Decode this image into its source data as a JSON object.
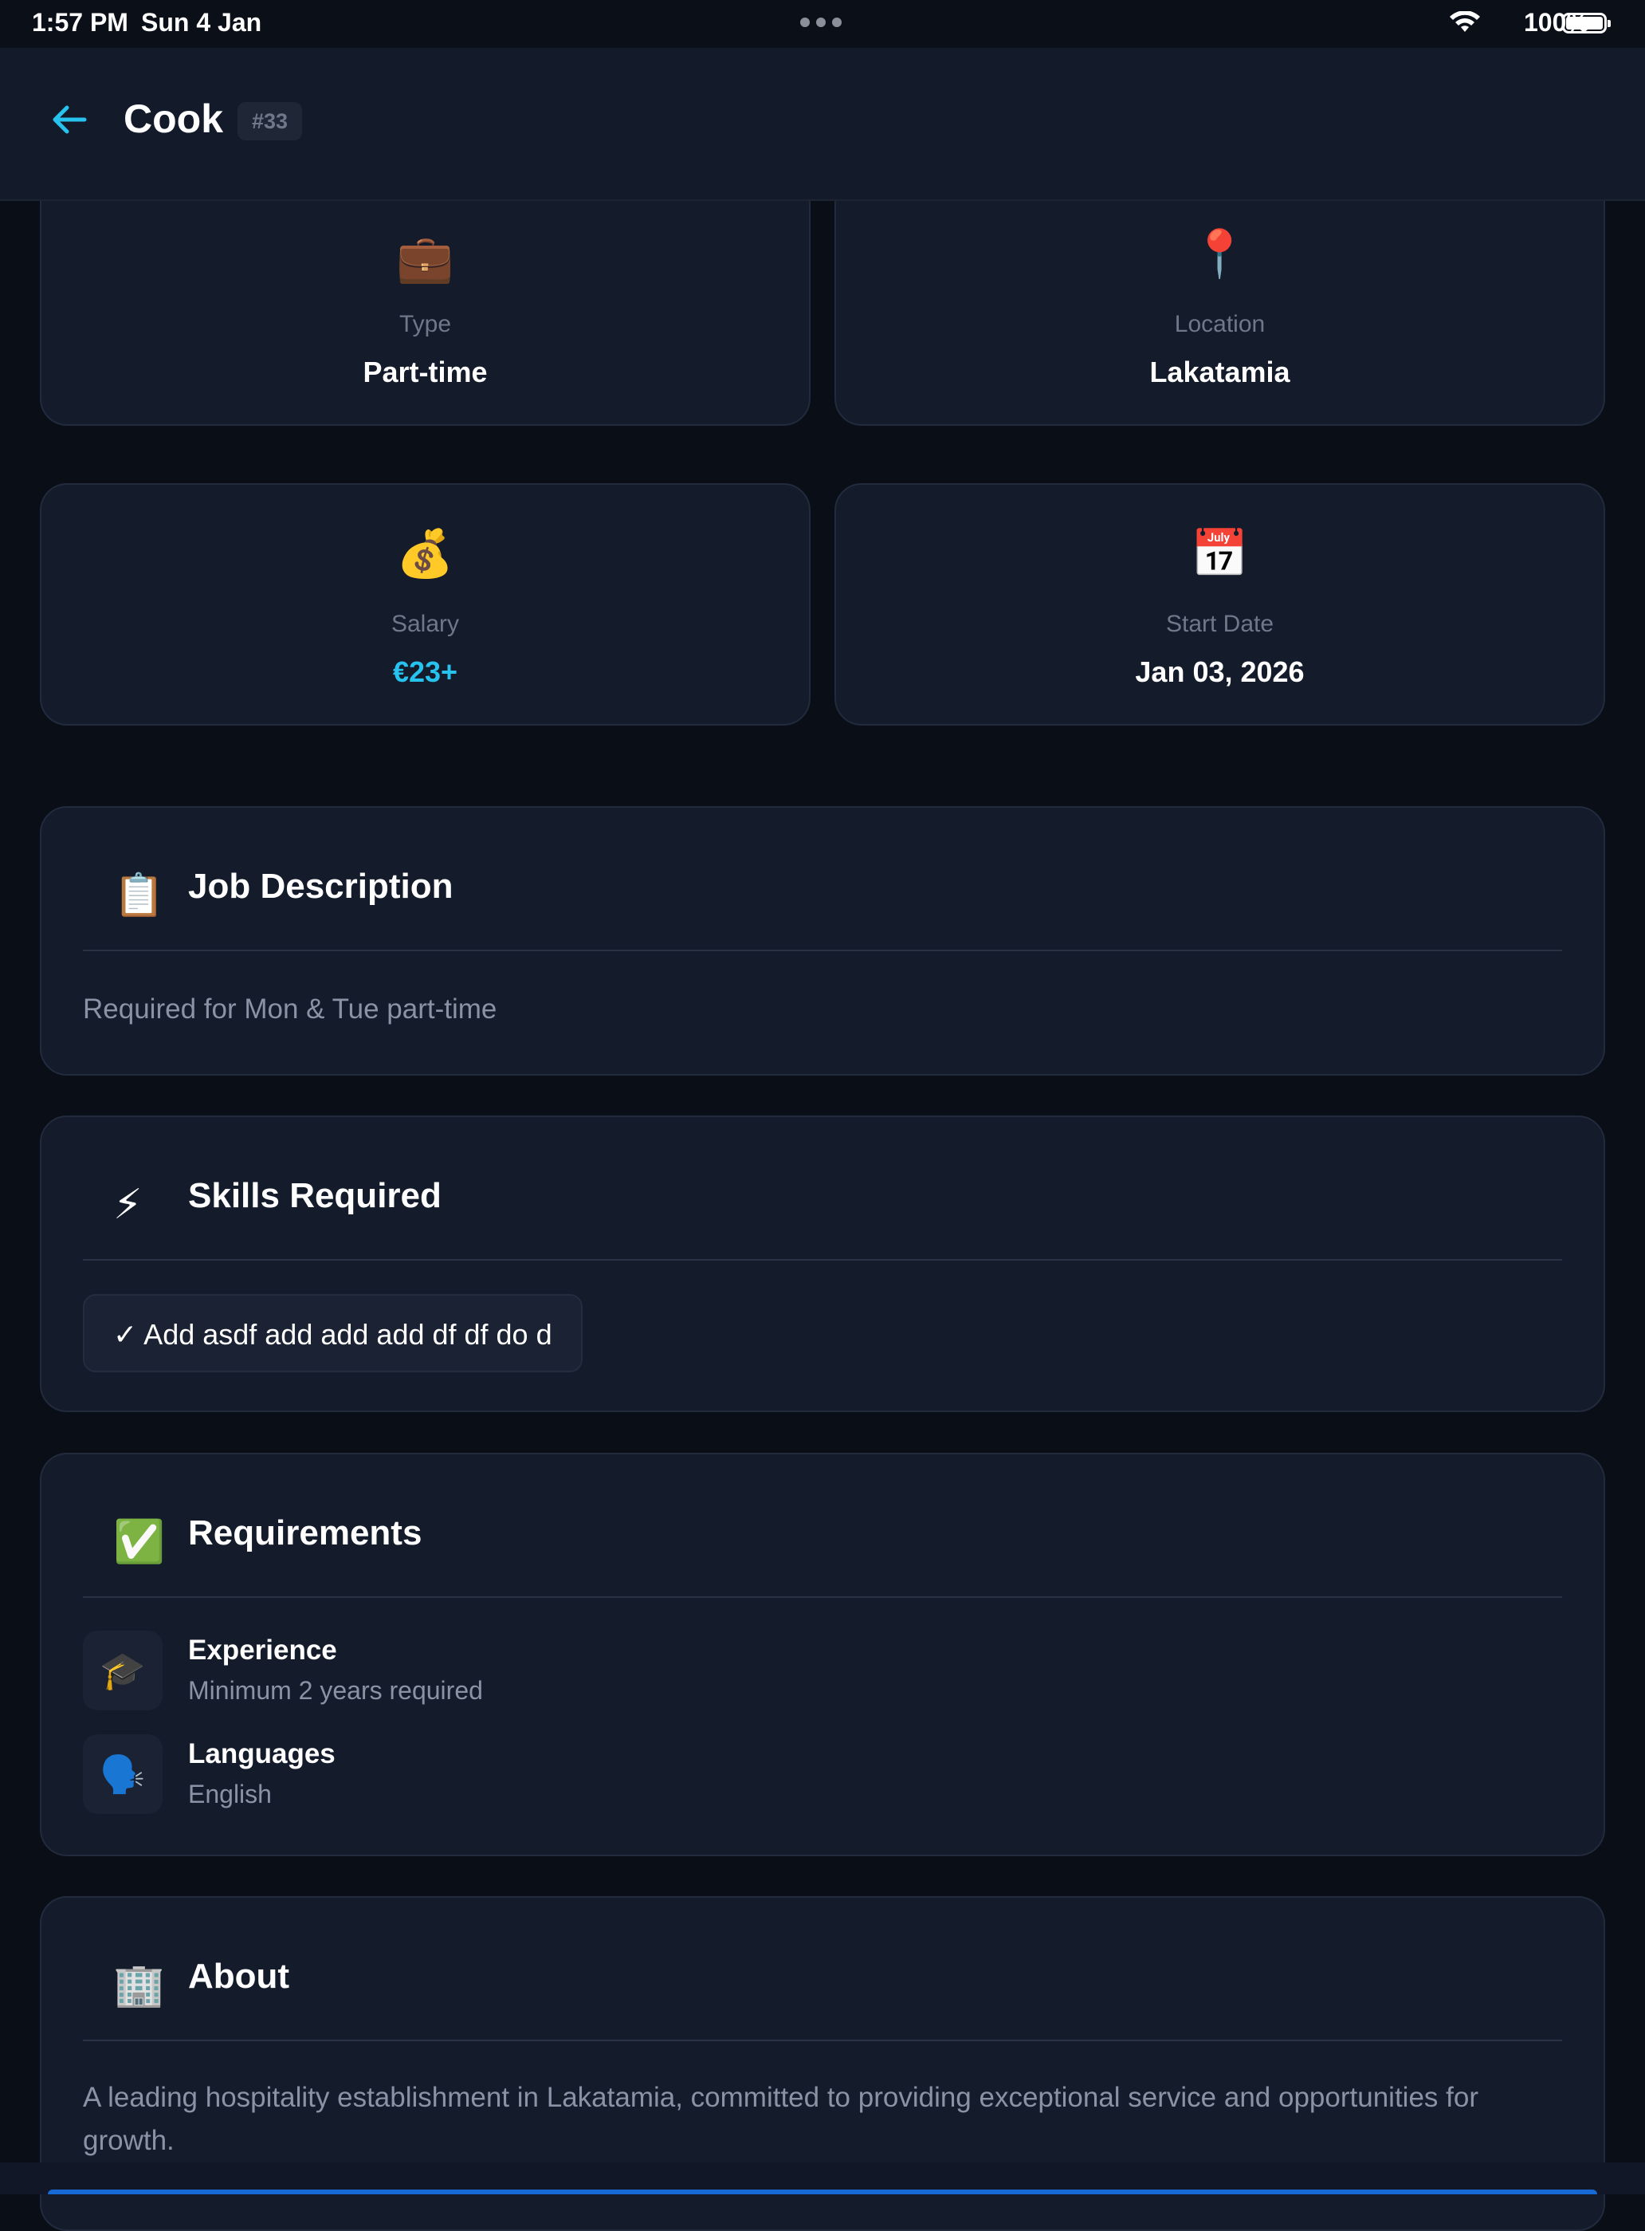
{
  "status_bar": {
    "time": "1:57 PM",
    "date": "Sun 4 Jan",
    "battery": "100%"
  },
  "header": {
    "title": "Cook",
    "id_badge": "#33",
    "back_icon": "arrow-left-icon",
    "accent_color": "#27c2ee"
  },
  "info_cards": {
    "type": {
      "icon": "💼",
      "label": "Type",
      "value": "Part-time"
    },
    "location": {
      "icon": "📍",
      "label": "Location",
      "value": "Lakatamia"
    },
    "salary": {
      "icon": "💰",
      "label": "Salary",
      "value": "€23+"
    },
    "start_date": {
      "icon": "📅",
      "label": "Start Date",
      "value": "Jan 03, 2026"
    }
  },
  "job_description": {
    "icon": "📋",
    "title": "Job Description",
    "text": "Required for Mon & Tue part-time"
  },
  "skills": {
    "icon": "⚡",
    "title": "Skills Required",
    "items": [
      "✓ Add asdf add add add df df do d"
    ]
  },
  "requirements": {
    "icon": "✅",
    "title": "Requirements",
    "experience": {
      "icon": "🎓",
      "title": "Experience",
      "value": "Minimum 2 years required"
    },
    "languages": {
      "icon": "🗣️",
      "title": "Languages",
      "value": "English"
    }
  },
  "about": {
    "icon": "🏢",
    "title": "About",
    "text": "A leading hospitality establishment in Lakatamia, committed to providing exceptional service and opportunities for growth."
  }
}
